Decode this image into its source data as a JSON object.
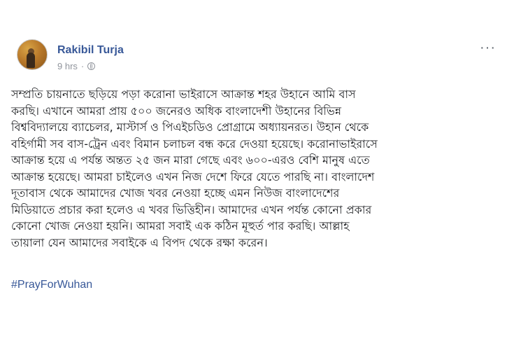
{
  "post": {
    "author_name": "Rakibil Turja",
    "time_label": "9 hrs",
    "separator": "·",
    "more_label": "···",
    "body_lines": [
      "সম্প্রতি চায়নাতে ছড়িয়ে পড়া করোনা ভাইরাসে আক্রান্ত শহর উহানে আমি বাস",
      "করছি। এখানে আমরা প্রায় ৫০০ জনেরও অধিক বাংলাদেশী উহানের বিভিন্ন",
      "বিশ্ববিদ্যালয়ে ব্যাচেলর, মাস্টার্স ও পিএইচডিও প্রোগ্রামে অধ্যায়নরত। উহান থেকে",
      "বহির্গামী সব বাস-ট্রেন এবং বিমান চলাচল বন্ধ করে দেওয়া হয়েছে। করোনাভাইরাসে",
      "আক্রান্ত হয়ে এ পর্যন্ত অন্তত ২৫ জন মারা গেছে এবং ৬০০-এরও বেশি মানুষ এতে",
      "আক্রান্ত হয়েছে। আমরা চাইলেও এখন নিজ দেশে ফিরে যেতে পারছি না। বাংলাদেশ",
      "দূতাবাস থেকে আমাদের খোজ খবর নেওয়া হচ্ছে এমন নিউজ বাংলাদেশের",
      "মিডিয়াতে প্রচার করা হলেও এ খবর ভিত্তিহীন। আমাদের এখন পর্যন্ত কোনো প্রকার",
      "কোনো খোজ নেওয়া হয়নি। আমরা সবাই এক কঠিন মূহুর্ত পার করছি। আল্লাহ",
      "তায়ালা যেন আমাদের সবাইকে এ বিপদ থেকে রক্ষা করেন।"
    ],
    "hashtag": "#PrayForWuhan"
  },
  "colors": {
    "author_link": "#385898",
    "hashtag": "#385898",
    "meta_text": "#90949c",
    "body_text": "#1c1e21"
  },
  "icons": {
    "privacy": "globe-icon",
    "menu": "more-options-icon"
  }
}
